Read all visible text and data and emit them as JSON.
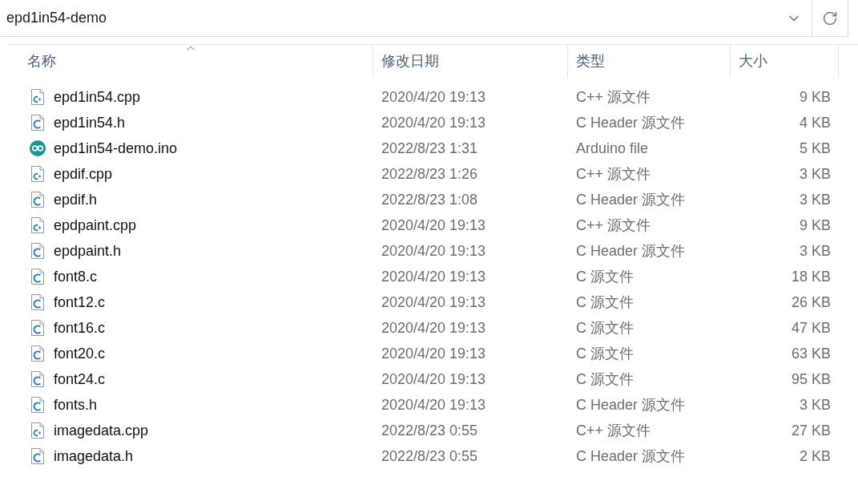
{
  "address_bar": {
    "path": "epd1in54-demo"
  },
  "columns": [
    {
      "label": "名称",
      "sorted": true
    },
    {
      "label": "修改日期",
      "sorted": false
    },
    {
      "label": "类型",
      "sorted": false
    },
    {
      "label": "大小",
      "sorted": false
    }
  ],
  "files": [
    {
      "kind": "cpp",
      "name": "epd1in54.cpp",
      "modified": "2020/4/20 19:13",
      "type": "C++ 源文件",
      "size": "9 KB"
    },
    {
      "kind": "c",
      "name": "epd1in54.h",
      "modified": "2020/4/20 19:13",
      "type": "C Header 源文件",
      "size": "4 KB"
    },
    {
      "kind": "ino",
      "name": "epd1in54-demo.ino",
      "modified": "2022/8/23 1:31",
      "type": "Arduino file",
      "size": "5 KB"
    },
    {
      "kind": "cpp",
      "name": "epdif.cpp",
      "modified": "2022/8/23 1:26",
      "type": "C++ 源文件",
      "size": "3 KB"
    },
    {
      "kind": "c",
      "name": "epdif.h",
      "modified": "2022/8/23 1:08",
      "type": "C Header 源文件",
      "size": "3 KB"
    },
    {
      "kind": "cpp",
      "name": "epdpaint.cpp",
      "modified": "2020/4/20 19:13",
      "type": "C++ 源文件",
      "size": "9 KB"
    },
    {
      "kind": "c",
      "name": "epdpaint.h",
      "modified": "2020/4/20 19:13",
      "type": "C Header 源文件",
      "size": "3 KB"
    },
    {
      "kind": "c",
      "name": "font8.c",
      "modified": "2020/4/20 19:13",
      "type": "C 源文件",
      "size": "18 KB"
    },
    {
      "kind": "c",
      "name": "font12.c",
      "modified": "2020/4/20 19:13",
      "type": "C 源文件",
      "size": "26 KB"
    },
    {
      "kind": "c",
      "name": "font16.c",
      "modified": "2020/4/20 19:13",
      "type": "C 源文件",
      "size": "47 KB"
    },
    {
      "kind": "c",
      "name": "font20.c",
      "modified": "2020/4/20 19:13",
      "type": "C 源文件",
      "size": "63 KB"
    },
    {
      "kind": "c",
      "name": "font24.c",
      "modified": "2020/4/20 19:13",
      "type": "C 源文件",
      "size": "95 KB"
    },
    {
      "kind": "c",
      "name": "fonts.h",
      "modified": "2020/4/20 19:13",
      "type": "C Header 源文件",
      "size": "3 KB"
    },
    {
      "kind": "cpp",
      "name": "imagedata.cpp",
      "modified": "2022/8/23 0:55",
      "type": "C++ 源文件",
      "size": "27 KB"
    },
    {
      "kind": "c",
      "name": "imagedata.h",
      "modified": "2022/8/23 0:55",
      "type": "C Header 源文件",
      "size": "2 KB"
    }
  ]
}
